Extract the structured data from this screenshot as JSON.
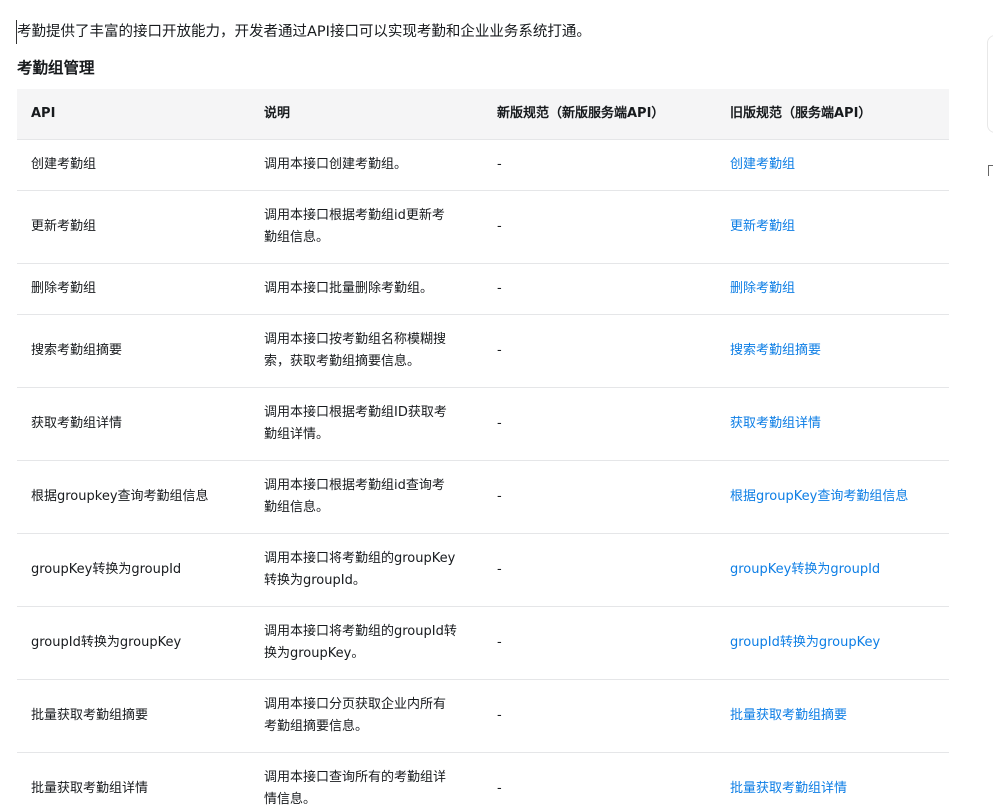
{
  "intro": "考勤提供了丰富的接口开放能力，开发者通过API接口可以实现考勤和企业业务系统打通。",
  "section_title": "考勤组管理",
  "table": {
    "headers": [
      "API",
      "说明",
      "新版规范（新版服务端API）",
      "旧版规范（服务端API）"
    ],
    "rows": [
      {
        "api": "创建考勤组",
        "desc": "调用本接口创建考勤组。",
        "new_spec": "-",
        "old_spec": "创建考勤组"
      },
      {
        "api": "更新考勤组",
        "desc": "调用本接口根据考勤组id更新考勤组信息。",
        "new_spec": "-",
        "old_spec": "更新考勤组"
      },
      {
        "api": "删除考勤组",
        "desc": "调用本接口批量删除考勤组。",
        "new_spec": "-",
        "old_spec": "删除考勤组"
      },
      {
        "api": "搜索考勤组摘要",
        "desc": "调用本接口按考勤组名称模糊搜索，获取考勤组摘要信息。",
        "new_spec": "-",
        "old_spec": "搜索考勤组摘要"
      },
      {
        "api": "获取考勤组详情",
        "desc": "调用本接口根据考勤组ID获取考勤组详情。",
        "new_spec": "-",
        "old_spec": "获取考勤组详情"
      },
      {
        "api": "根据groupkey查询考勤组信息",
        "desc": "调用本接口根据考勤组id查询考勤组信息。",
        "new_spec": "-",
        "old_spec": "根据groupKey查询考勤组信息"
      },
      {
        "api": "groupKey转换为groupId",
        "desc": "调用本接口将考勤组的groupKey转换为groupId。",
        "new_spec": "-",
        "old_spec": "groupKey转换为groupId"
      },
      {
        "api": "groupId转换为groupKey",
        "desc": "调用本接口将考勤组的groupId转换为groupKey。",
        "new_spec": "-",
        "old_spec": "groupId转换为groupKey"
      },
      {
        "api": "批量获取考勤组摘要",
        "desc": "调用本接口分页获取企业内所有考勤组摘要信息。",
        "new_spec": "-",
        "old_spec": "批量获取考勤组摘要"
      },
      {
        "api": "批量获取考勤组详情",
        "desc": "调用本接口查询所有的考勤组详情信息。",
        "new_spec": "-",
        "old_spec": "批量获取考勤组详情"
      }
    ]
  },
  "colors": {
    "link": "#0d7ee5",
    "header_bg": "#f5f5f6",
    "border": "#e5e6e8",
    "text": "#171a1d"
  }
}
